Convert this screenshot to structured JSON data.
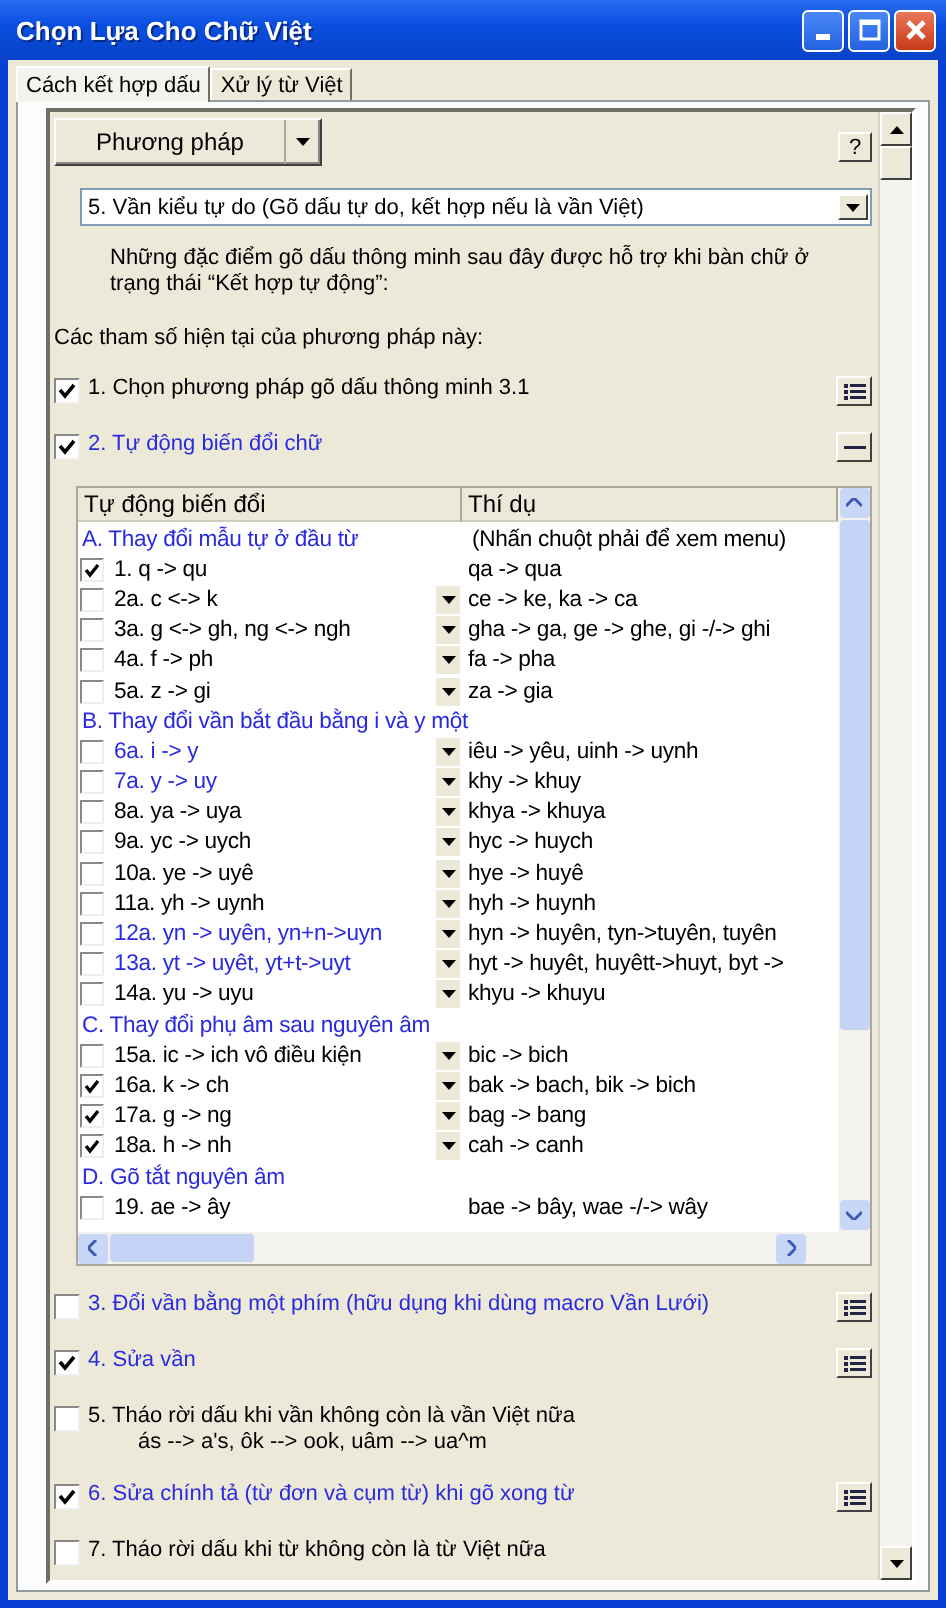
{
  "window": {
    "title": "Chọn Lựa Cho Chữ Việt"
  },
  "tabs": [
    {
      "label": "Cách kết hợp dấu",
      "selected": true
    },
    {
      "label": "Xử lý từ Việt",
      "selected": false
    }
  ],
  "method_button": {
    "label": "Phương pháp"
  },
  "help_button": {
    "label": "?"
  },
  "method_select": {
    "value": "5. Vần kiểu tự do (Gõ dấu tự do, kết hợp nếu là vần Việt)"
  },
  "description": "Những đặc điểm gõ dấu thông minh sau đây được hỗ trợ khi bàn chữ ở  trạng thái “Kết hợp tự động”:",
  "parameters_heading": "Các tham số hiện tại của phương pháp này:",
  "options": [
    {
      "label": "1. Chọn phương pháp gõ dấu thông minh 3.1",
      "checked": true,
      "highlighted": false,
      "kind": "list"
    },
    {
      "label": "2. Tự động biến đổi chữ",
      "checked": true,
      "highlighted": true,
      "kind": "collapse",
      "table": {
        "columns": [
          "Tự động biến đổi",
          "Thí dụ"
        ],
        "rows": [
          {
            "kind": "group",
            "text": "A. Thay đổi mẫu tự ở đầu từ",
            "example": "(Nhấn chuột phải để xem menu)"
          },
          {
            "kind": "item",
            "text": "1. q -> qu",
            "example": "qa -> qua",
            "checked": true,
            "highlighted": false,
            "dropdown": false
          },
          {
            "kind": "item",
            "text": "2a. c <-> k",
            "example": "ce -> ke, ka -> ca",
            "checked": false,
            "highlighted": false,
            "dropdown": true
          },
          {
            "kind": "item",
            "text": "3a. g <-> gh, ng <-> ngh",
            "example": "gha -> ga, ge -> ghe, gi -/-> ghi",
            "checked": false,
            "highlighted": false,
            "dropdown": true
          },
          {
            "kind": "item",
            "text": "4a. f -> ph",
            "example": "fa -> pha",
            "checked": false,
            "highlighted": false,
            "dropdown": true
          },
          {
            "kind": "item",
            "text": "5a. z -> gi",
            "example": "za -> gia",
            "checked": false,
            "highlighted": false,
            "dropdown": true
          },
          {
            "kind": "group",
            "text": "B. Thay đổi vần bắt đầu bằng i và y một"
          },
          {
            "kind": "item",
            "text": "6a. i -> y",
            "example": "iêu -> yêu, uinh -> uynh",
            "checked": false,
            "highlighted": true,
            "dropdown": true
          },
          {
            "kind": "item",
            "text": "7a. y -> uy",
            "example": "khy -> khuy",
            "checked": false,
            "highlighted": true,
            "dropdown": true
          },
          {
            "kind": "item",
            "text": "8a. ya -> uya",
            "example": "khya -> khuya",
            "checked": false,
            "highlighted": false,
            "dropdown": true
          },
          {
            "kind": "item",
            "text": "9a. yc -> uych",
            "example": "hyc -> huych",
            "checked": false,
            "highlighted": false,
            "dropdown": true
          },
          {
            "kind": "item",
            "text": "10a. ye -> uyê",
            "example": "hye -> huyê",
            "checked": false,
            "highlighted": false,
            "dropdown": true
          },
          {
            "kind": "item",
            "text": "11a. yh -> uynh",
            "example": "hyh -> huynh",
            "checked": false,
            "highlighted": false,
            "dropdown": true
          },
          {
            "kind": "item",
            "text": "12a. yn -> uyên, yn+n->uyn",
            "example": "hyn -> huyên, tyn->tuyên, tuyên",
            "checked": false,
            "highlighted": true,
            "dropdown": true
          },
          {
            "kind": "item",
            "text": "13a. yt -> uyêt, yt+t->uyt",
            "example": "hyt -> huyêt, huyêtt->huyt, byt ->",
            "checked": false,
            "highlighted": true,
            "dropdown": true
          },
          {
            "kind": "item",
            "text": "14a. yu -> uyu",
            "example": "khyu -> khuyu",
            "checked": false,
            "highlighted": false,
            "dropdown": true
          },
          {
            "kind": "group",
            "text": "C. Thay đổi phụ âm sau nguyên âm"
          },
          {
            "kind": "item",
            "text": "15a. ic -> ich vô điều kiện",
            "example": "bic -> bich",
            "checked": false,
            "highlighted": false,
            "dropdown": true
          },
          {
            "kind": "item",
            "text": "16a. k -> ch",
            "example": "bak -> bach, bik -> bich",
            "checked": true,
            "highlighted": false,
            "dropdown": true
          },
          {
            "kind": "item",
            "text": "17a. g -> ng",
            "example": "bag -> bang",
            "checked": true,
            "highlighted": false,
            "dropdown": true
          },
          {
            "kind": "item",
            "text": "18a. h -> nh",
            "example": "cah -> canh",
            "checked": true,
            "highlighted": false,
            "dropdown": true
          },
          {
            "kind": "group",
            "text": "D. Gõ tắt nguyên âm"
          },
          {
            "kind": "item",
            "text": "19. ae -> ây",
            "example": "bae -> bây, wae -/-> wây",
            "checked": false,
            "highlighted": false,
            "dropdown": false
          }
        ]
      }
    },
    {
      "label": "3. Đổi vần bằng một phím (hữu dụng khi dùng macro Vần Lưới)",
      "checked": false,
      "highlighted": true,
      "kind": "list"
    },
    {
      "label": "4. Sửa vần",
      "checked": true,
      "highlighted": true,
      "kind": "list"
    },
    {
      "label": "5. Tháo rời dấu khi vần không còn là vần Việt nữa",
      "detail": "ás --> a's, ôk --> ook,  uâm --> ua^m",
      "checked": false,
      "highlighted": false,
      "kind": "plain"
    },
    {
      "label": "6. Sửa chính tả (từ đơn và cụm từ) khi gõ xong từ",
      "checked": true,
      "highlighted": true,
      "kind": "list"
    },
    {
      "label": "7.  Tháo rời dấu khi từ không còn là từ Việt nữa",
      "checked": false,
      "highlighted": false,
      "kind": "plain"
    }
  ]
}
